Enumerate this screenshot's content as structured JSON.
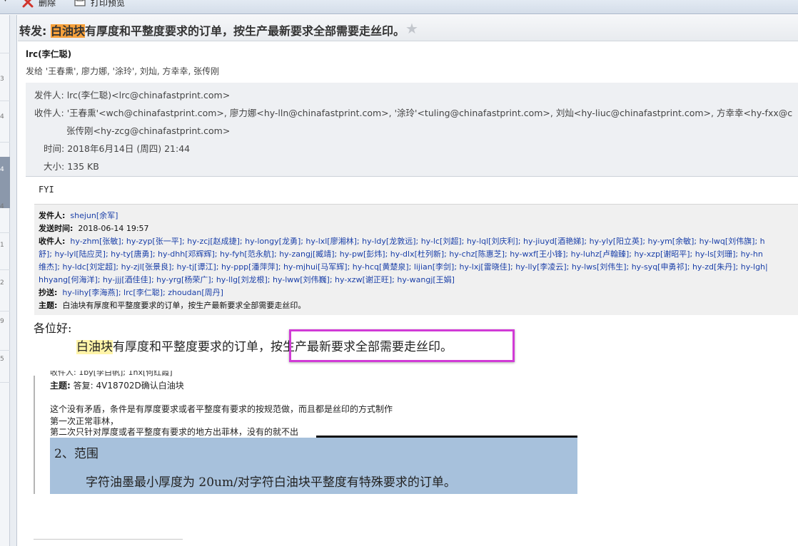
{
  "toolbar": {
    "delete_label": "删除",
    "print_preview_label": "打印预览"
  },
  "message_list": {
    "row_numbers": [
      "3",
      "4",
      "4",
      "4",
      "1",
      "2",
      "9",
      "5"
    ]
  },
  "email": {
    "subject_prefix": "转发: ",
    "subject_highlight": "白油块",
    "subject_rest": "有厚度和平整度要求的订单，按生产最新要求全部需要走丝印。",
    "sender_display": "lrc(李仁聪)",
    "sent_to_line": "发给 '王春熏', 廖力娜, '涂玲', 刘灿, 方幸幸, 张传刚",
    "headers": {
      "from_label": "发件人:",
      "from_value": "lrc(李仁聪)<lrc@chinafastprint.com>",
      "to_label": "收件人:",
      "to_value_line1": "'王春熏'<wch@chinafastprint.com>, 廖力娜<hy-lln@chinafastprint.com>, '涂玲'<tuling@chinafastprint.com>, 刘灿<hy-liuc@chinafastprint.com>, 方幸幸<hy-fxx@c",
      "to_value_line2": "张传刚<hy-zcg@chinafastprint.com>",
      "time_label": "时间:",
      "time_value": "2018年6月14日 (周四) 21:44",
      "size_label": "大小:",
      "size_value": "135 KB"
    },
    "body": {
      "fyi": "FYI",
      "forwarded": {
        "from_label": "发件人:",
        "from_value": "shejun[余军]",
        "sent_label": "发送时间:",
        "sent_value": "2018-06-14 19:57",
        "to_label": "收件人:",
        "to_line1": "hy-zhm[张敏]; hy-zyp[张一平]; hy-zcj[赵成捷]; hy-longy[龙勇]; hy-lxl[廖湘林]; hy-ldy[龙敦远]; hy-lc[刘超]; hy-lql[刘庆利]; hy-jiuyd[酒艳娣]; hy-yly[阳立英]; hy-ym[余敏]; hy-lwq[刘伟旗]; h",
        "to_line2": "舒]; hy-lyl[陆应灵]; hy-ty[唐勇]; hy-dhh[邓辉辉]; hy-fyh[范永航]; hy-zangj[臧靖]; hy-pw[彭炜]; hy-dlx[杜列新]; hy-chz[陈惠芝]; hy-wxf[王小锋]; hy-luhz[卢翰臻]; hy-xzp[谢昭平]; hy-ls[刘珊]; hy-hn",
        "to_line3": "维杰]; hy-ldc[刘定超]; hy-zjl[张景良]; hy-tj[谭江]; hy-ppp[潘萍萍]; hy-mjhui[马军辉]; hy-hcq[黄楚泉]; lijian[李剑]; hy-lxj[雷晓佳]; hy-lly[李凌云]; hy-lws[刘伟生]; hy-syq[申勇祁]; hy-zd[朱丹]; hy-lgh|",
        "to_line4": "hhyang[何海洋]; hy-jjj[酒佳佳]; hy-yrg[杨荣广]; hy-llg[刘龙根]; hy-lww[刘伟巍]; hy-xzw[谢正旺]; hy-wangj[王娟]",
        "cc_label": "抄送:",
        "cc_value": "hy-lihy[李海燕]; lrc[李仁聪]; zhoudan[周丹]",
        "subject_label": "主题:",
        "subject_value": "白油块有厚度和平整度要求的订单，按生产最新要求全部需要走丝印。"
      },
      "greeting": "各位好:",
      "main_highlight": "白油块",
      "main_middle": "有厚度和平整度要求的订单，",
      "main_boxed": "按生产最新要求全部需要走丝印。",
      "quoted": {
        "cut_top": "收件人: 1by[李白帆]; 1hx[何红霞]",
        "subject_label": "主题:",
        "subject_value": "答复: 4V18702D确认白油块",
        "line1": "这个没有矛盾，条件是有厚度要求或者平整度有要求的按规范做，而且都是丝印的方式制作",
        "line2": "第一次正常菲林，",
        "line3": "第二次只针对厚度或者平整度有要求的地方出菲林，没有的就不出",
        "scan_heading": "2、范围",
        "scan_text": "字符油墨最小厚度为 20um/对字符白油块平整度有特殊要求的订单。"
      }
    }
  }
}
